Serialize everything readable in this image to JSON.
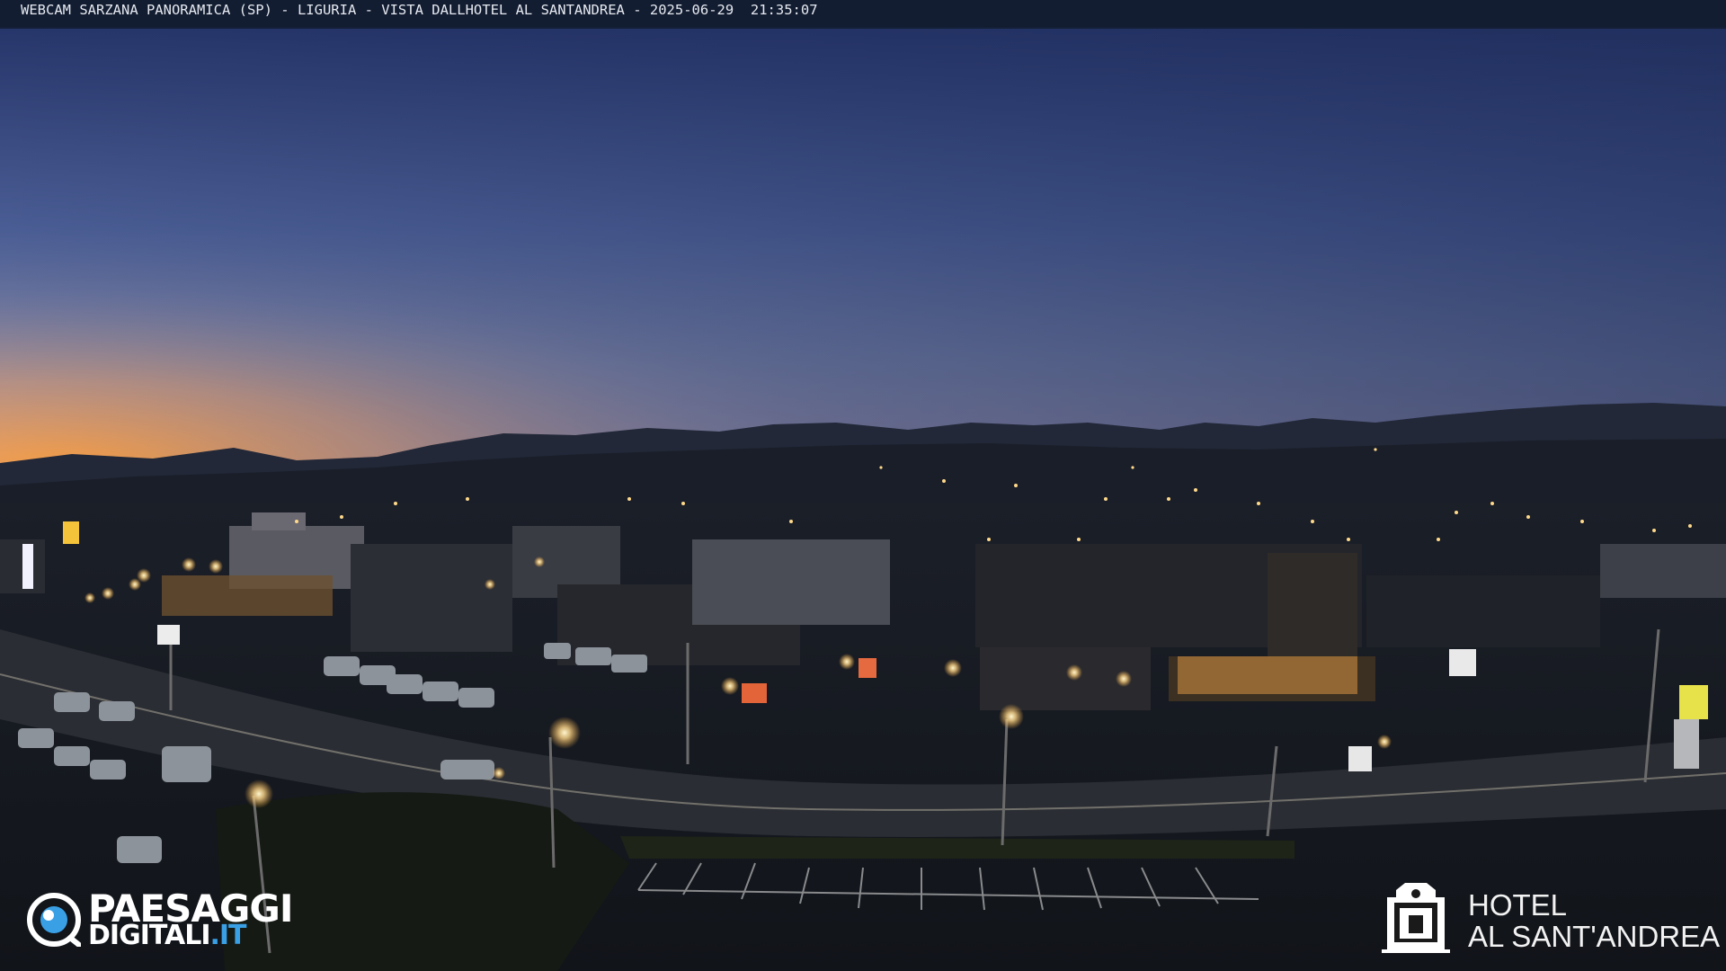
{
  "overlay": {
    "title": "WEBCAM SARZANA PANORAMICA (SP) - LIGURIA - VISTA DALLHOTEL AL SANTANDREA - 2025-06-29  21:35:07"
  },
  "logos": {
    "left": {
      "line1": "PAESAGGI",
      "line2": "DIGITALI",
      "line2_suffix": ".IT"
    },
    "right": {
      "line1": "HOTEL",
      "line2": "AL SANT'ANDREA"
    }
  },
  "colors": {
    "sky_top": "#2c3a6e",
    "sky_mid": "#4b5f95",
    "sky_horizon_warm": "#f3a24b",
    "mountains": "#1a1f2c",
    "ground": "#161a21",
    "lights": "#ffe9a8",
    "logo_accent": "#3aa0e6"
  }
}
